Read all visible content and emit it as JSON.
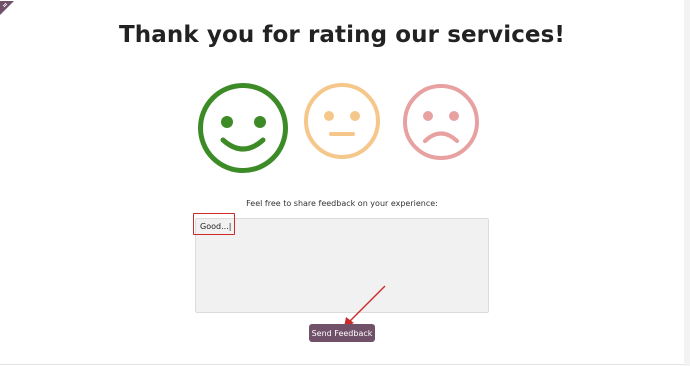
{
  "page": {
    "title": "Thank you for rating our services!"
  },
  "ratings": [
    {
      "name": "satisfied",
      "color": "#3d8b26"
    },
    {
      "name": "neutral",
      "color": "#f5c78a"
    },
    {
      "name": "dissatisfied",
      "color": "#e8a1a1"
    }
  ],
  "feedback": {
    "prompt": "Feel free to share feedback on your experience:",
    "value": "Good...|"
  },
  "actions": {
    "send_label": "Send Feedback"
  },
  "colors": {
    "accent": "#71506a",
    "annotation": "#cc2a2a",
    "input_background": "#f1f1f1"
  }
}
